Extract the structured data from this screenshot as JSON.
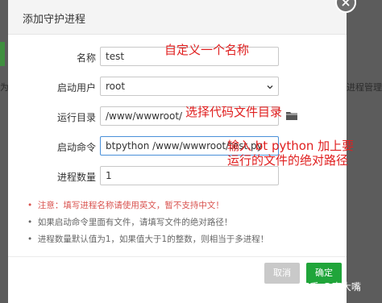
{
  "background": {
    "left_partial_text": "为动命",
    "right_partial_text": "进程管理"
  },
  "dialog": {
    "title": "添加守护进程"
  },
  "form": {
    "name_label": "名称",
    "name_value": "test",
    "user_label": "启动用户",
    "user_value": "root",
    "dir_label": "运行目录",
    "dir_value": "/www/wwwroot/",
    "cmd_label": "启动命令",
    "cmd_value": "btpython /www/wwwroot/test.py",
    "count_label": "进程数量",
    "count_value": "1"
  },
  "notes": [
    "注意：填写进程名称请使用英文，暂不支持中文！",
    "如果启动命令里面有文件，请填写文件的绝对路径！",
    "进程数量默认值为1，如果值大于1的整数，则相当于多进程！"
  ],
  "footer": {
    "cancel_label": "取消",
    "confirm_label": "确定"
  },
  "annotations": {
    "name": "自定义一个名称",
    "dir": "选择代码文件目录",
    "cmd_line1": "输入 bt python 加上要",
    "cmd_line2": "运行的文件的绝对路径"
  },
  "watermark": "知乎 @李大嘴",
  "colors": {
    "accent_green": "#20a53a",
    "annotation_red": "#e02020",
    "warning_red": "#d9534f",
    "focus_blue": "#4a90d9"
  },
  "icons": {
    "close": "close-icon",
    "folder": "folder-icon",
    "select": "chevron-down-icon"
  }
}
